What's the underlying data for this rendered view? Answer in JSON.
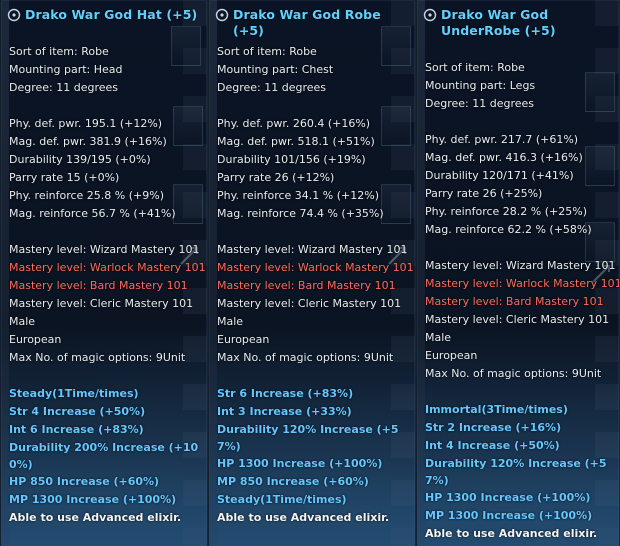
{
  "panels": [
    {
      "title": "Drako War God Hat (+5)",
      "icon": "item-icon",
      "basic": [
        "Sort of item: Robe",
        "Mounting part: Head",
        "Degree: 11 degrees"
      ],
      "stats": [
        "Phy. def. pwr. 195.1 (+12%)",
        "Mag. def. pwr. 381.9 (+16%)",
        "Durability 139/195 (+0%)",
        "Parry rate 15 (+0%)",
        "Phy.  reinforce 25.8 % (+9%)",
        "Mag. reinforce 56.7 % (+41%)"
      ],
      "requirements": [
        "Mastery level: Wizard Mastery 101",
        "Mastery level: Warlock Mastery 101",
        "Mastery level: Bard Mastery 101",
        "Mastery level: Cleric Mastery 101",
        "Male",
        "European",
        "Max No. of magic options: 9Unit"
      ],
      "bonuses": [
        "Steady(1Time/times)",
        "Str 4 Increase (+50%)",
        "Int 6 Increase (+83%)",
        "Durability 200% Increase (+100%)",
        "HP 850 Increase (+60%)",
        "MP 1300 Increase (+100%)",
        "Able to use Advanced elixir."
      ]
    },
    {
      "title": "Drako War God Robe (+5)",
      "icon": "item-icon",
      "basic": [
        "Sort of item: Robe",
        "Mounting part: Chest",
        "Degree: 11 degrees"
      ],
      "stats": [
        "Phy. def. pwr. 260.4 (+16%)",
        "Mag. def. pwr. 518.1 (+51%)",
        "Durability 101/156 (+19%)",
        "Parry rate 26 (+12%)",
        "Phy.  reinforce 34.1 % (+12%)",
        "Mag. reinforce 74.4 % (+35%)"
      ],
      "requirements": [
        "Mastery level: Wizard Mastery 101",
        "Mastery level: Warlock Mastery 101",
        "Mastery level: Bard Mastery 101",
        "Mastery level: Cleric Mastery 101",
        "Male",
        "European",
        "Max No. of magic options: 9Unit"
      ],
      "bonuses": [
        "Str 6 Increase (+83%)",
        "Int 3 Increase (+33%)",
        "Durability 120% Increase (+57%)",
        "HP 1300 Increase (+100%)",
        "MP 850 Increase (+60%)",
        "Steady(1Time/times)",
        "Able to use Advanced elixir."
      ]
    },
    {
      "title": "Drako War God UnderRobe (+5)",
      "icon": "item-icon",
      "basic": [
        "Sort of item: Robe",
        "Mounting part: Legs",
        "Degree: 11 degrees"
      ],
      "stats": [
        "Phy. def. pwr. 217.7 (+61%)",
        "Mag. def. pwr. 416.3 (+16%)",
        "Durability 120/171 (+41%)",
        "Parry rate 26 (+25%)",
        "Phy.  reinforce 28.2 % (+25%)",
        "Mag. reinforce 62.2 % (+58%)"
      ],
      "requirements": [
        "Mastery level: Wizard Mastery 101",
        "Mastery level: Warlock Mastery 101",
        "Mastery level: Bard Mastery 101",
        "Mastery level: Cleric Mastery 101",
        "Male",
        "European",
        "Max No. of magic options: 9Unit"
      ],
      "bonuses": [
        "Immortal(3Time/times)",
        "Str 2 Increase (+16%)",
        "Int 4 Increase (+50%)",
        "Durability 120% Increase (+57%)",
        "HP 1300 Increase (+100%)",
        "MP 1300 Increase (+100%)",
        "Able to use Advanced elixir."
      ]
    }
  ],
  "colors": {
    "title": "#5fd0ff",
    "text": "#e8ecef",
    "warning": "#ff6a58",
    "bonus": "#64c7ff"
  }
}
